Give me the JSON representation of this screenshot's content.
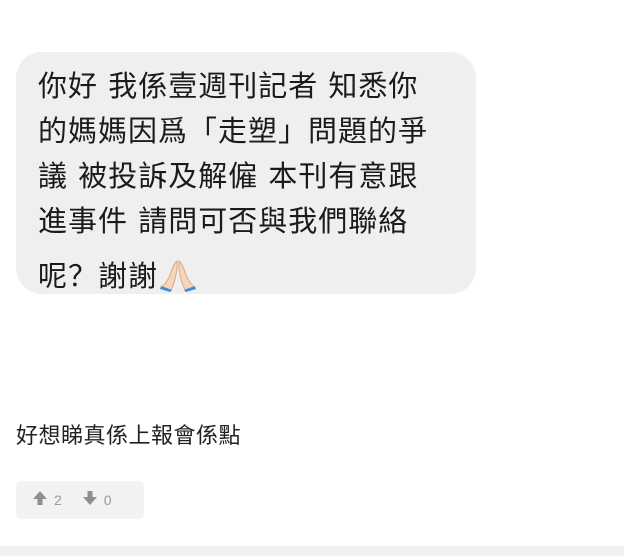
{
  "message_bubble": {
    "lines": [
      "你好 我係壹週刊記者 知悉你",
      "的媽媽因爲「走塑」問題的爭",
      "議 被投訴及解僱 本刊有意跟",
      "進事件 請問可否與我們聯絡",
      "呢？謝謝"
    ],
    "emoji": "folded-hands-icon"
  },
  "comment": {
    "text": "好想睇真係上報會係點"
  },
  "votes": {
    "upvotes": "2",
    "downvotes": "0",
    "up_icon": "arrow-up-icon",
    "down_icon": "arrow-down-icon",
    "count_color": "#9a9a9a"
  },
  "colors": {
    "bubble_background": "#efefef",
    "vote_background": "#f2f2f2"
  }
}
